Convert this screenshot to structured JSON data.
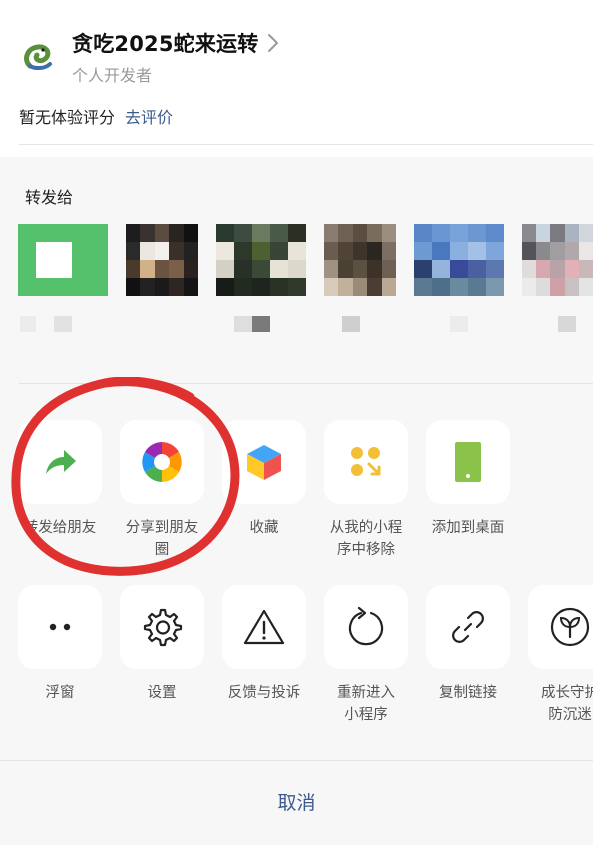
{
  "app": {
    "title": "贪吃2025蛇来运转",
    "developer": "个人开发者",
    "rating_text": "暂无体验评分",
    "rating_link": "去评价"
  },
  "share": {
    "title": "转发给",
    "contacts": [
      {
        "avatar": "green-square-avatar"
      },
      {
        "avatar": "pixelated-avatar"
      },
      {
        "avatar": "pixelated-avatar"
      },
      {
        "avatar": "pixelated-avatar"
      },
      {
        "avatar": "pixelated-avatar"
      },
      {
        "avatar": "pixelated-avatar"
      }
    ]
  },
  "actions_row1": [
    {
      "label": "转发给朋友",
      "icon": "share-arrow-icon"
    },
    {
      "label": "分享到朋友\n圈",
      "icon": "moments-aperture-icon"
    },
    {
      "label": "收藏",
      "icon": "cube-icon"
    },
    {
      "label": "从我的小程\n序中移除",
      "icon": "remove-miniprogram-icon"
    },
    {
      "label": "添加到桌面",
      "icon": "phone-icon"
    }
  ],
  "actions_row2": [
    {
      "label": "浮窗",
      "icon": "float-window-icon"
    },
    {
      "label": "设置",
      "icon": "gear-icon"
    },
    {
      "label": "反馈与投诉",
      "icon": "warning-icon"
    },
    {
      "label": "重新进入\n小程序",
      "icon": "reload-icon"
    },
    {
      "label": "复制链接",
      "icon": "link-icon"
    },
    {
      "label": "成长守护\n防沉迷",
      "icon": "sprout-icon"
    }
  ],
  "cancel_label": "取消",
  "colors": {
    "accent_green": "#4CAF50",
    "link_blue": "#3d5a8c",
    "annotation_red": "#e03131"
  }
}
